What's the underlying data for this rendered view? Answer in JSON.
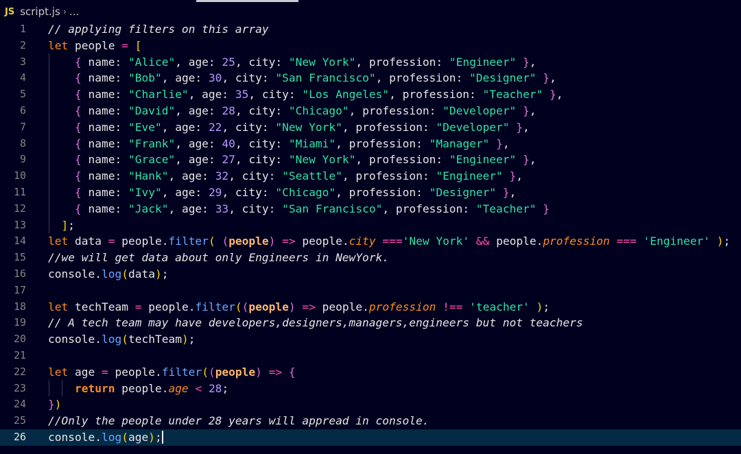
{
  "breadcrumb": {
    "lang_badge": "JS",
    "file": "script.js",
    "separator": "›",
    "more": "..."
  },
  "editor": {
    "current_line": 26,
    "lines": [
      {
        "n": "1",
        "tokens": [
          [
            "cmt",
            "// applying filters on this array"
          ]
        ]
      },
      {
        "n": "2",
        "tokens": [
          [
            "kw",
            "let"
          ],
          [
            "var",
            " people "
          ],
          [
            "op",
            "="
          ],
          [
            "var",
            " "
          ],
          [
            "b1",
            "["
          ]
        ]
      },
      {
        "n": "3",
        "indent": "    ",
        "tokens": [
          [
            "b2",
            "{"
          ],
          [
            "prop",
            " name: "
          ],
          [
            "str",
            "\"Alice\""
          ],
          [
            "punc",
            ", age: "
          ],
          [
            "num",
            "25"
          ],
          [
            "punc",
            ", city: "
          ],
          [
            "str",
            "\"New York\""
          ],
          [
            "punc",
            ", profession: "
          ],
          [
            "str",
            "\"Engineer\""
          ],
          [
            "punc",
            " "
          ],
          [
            "b2",
            "}"
          ],
          [
            "punc",
            ","
          ]
        ]
      },
      {
        "n": "4",
        "indent": "    ",
        "tokens": [
          [
            "b2",
            "{"
          ],
          [
            "prop",
            " name: "
          ],
          [
            "str",
            "\"Bob\""
          ],
          [
            "punc",
            ", age: "
          ],
          [
            "num",
            "30"
          ],
          [
            "punc",
            ", city: "
          ],
          [
            "str",
            "\"San Francisco\""
          ],
          [
            "punc",
            ", profession: "
          ],
          [
            "str",
            "\"Designer\""
          ],
          [
            "punc",
            " "
          ],
          [
            "b2",
            "}"
          ],
          [
            "punc",
            ","
          ]
        ]
      },
      {
        "n": "5",
        "indent": "    ",
        "tokens": [
          [
            "b2",
            "{"
          ],
          [
            "prop",
            " name: "
          ],
          [
            "str",
            "\"Charlie\""
          ],
          [
            "punc",
            ", age: "
          ],
          [
            "num",
            "35"
          ],
          [
            "punc",
            ", city: "
          ],
          [
            "str",
            "\"Los Angeles\""
          ],
          [
            "punc",
            ", profession: "
          ],
          [
            "str",
            "\"Teacher\""
          ],
          [
            "punc",
            " "
          ],
          [
            "b2",
            "}"
          ],
          [
            "punc",
            ","
          ]
        ]
      },
      {
        "n": "6",
        "indent": "    ",
        "tokens": [
          [
            "b2",
            "{"
          ],
          [
            "prop",
            " name: "
          ],
          [
            "str",
            "\"David\""
          ],
          [
            "punc",
            ", age: "
          ],
          [
            "num",
            "28"
          ],
          [
            "punc",
            ", city: "
          ],
          [
            "str",
            "\"Chicago\""
          ],
          [
            "punc",
            ", profession: "
          ],
          [
            "str",
            "\"Developer\""
          ],
          [
            "punc",
            " "
          ],
          [
            "b2",
            "}"
          ],
          [
            "punc",
            ","
          ]
        ]
      },
      {
        "n": "7",
        "indent": "    ",
        "tokens": [
          [
            "b2",
            "{"
          ],
          [
            "prop",
            " name: "
          ],
          [
            "str",
            "\"Eve\""
          ],
          [
            "punc",
            ", age: "
          ],
          [
            "num",
            "22"
          ],
          [
            "punc",
            ", city: "
          ],
          [
            "str",
            "\"New York\""
          ],
          [
            "punc",
            ", profession: "
          ],
          [
            "str",
            "\"Developer\""
          ],
          [
            "punc",
            " "
          ],
          [
            "b2",
            "}"
          ],
          [
            "punc",
            ","
          ]
        ]
      },
      {
        "n": "8",
        "indent": "    ",
        "tokens": [
          [
            "b2",
            "{"
          ],
          [
            "prop",
            " name: "
          ],
          [
            "str",
            "\"Frank\""
          ],
          [
            "punc",
            ", age: "
          ],
          [
            "num",
            "40"
          ],
          [
            "punc",
            ", city: "
          ],
          [
            "str",
            "\"Miami\""
          ],
          [
            "punc",
            ", profession: "
          ],
          [
            "str",
            "\"Manager\""
          ],
          [
            "punc",
            " "
          ],
          [
            "b2",
            "}"
          ],
          [
            "punc",
            ","
          ]
        ]
      },
      {
        "n": "9",
        "indent": "    ",
        "tokens": [
          [
            "b2",
            "{"
          ],
          [
            "prop",
            " name: "
          ],
          [
            "str",
            "\"Grace\""
          ],
          [
            "punc",
            ", age: "
          ],
          [
            "num",
            "27"
          ],
          [
            "punc",
            ", city: "
          ],
          [
            "str",
            "\"New York\""
          ],
          [
            "punc",
            ", profession: "
          ],
          [
            "str",
            "\"Engineer\""
          ],
          [
            "punc",
            " "
          ],
          [
            "b2",
            "}"
          ],
          [
            "punc",
            ","
          ]
        ]
      },
      {
        "n": "10",
        "indent": "    ",
        "tokens": [
          [
            "b2",
            "{"
          ],
          [
            "prop",
            " name: "
          ],
          [
            "str",
            "\"Hank\""
          ],
          [
            "punc",
            ", age: "
          ],
          [
            "num",
            "32"
          ],
          [
            "punc",
            ", city: "
          ],
          [
            "str",
            "\"Seattle\""
          ],
          [
            "punc",
            ", profession: "
          ],
          [
            "str",
            "\"Engineer\""
          ],
          [
            "punc",
            " "
          ],
          [
            "b2",
            "}"
          ],
          [
            "punc",
            ","
          ]
        ]
      },
      {
        "n": "11",
        "indent": "    ",
        "tokens": [
          [
            "b2",
            "{"
          ],
          [
            "prop",
            " name: "
          ],
          [
            "str",
            "\"Ivy\""
          ],
          [
            "punc",
            ", age: "
          ],
          [
            "num",
            "29"
          ],
          [
            "punc",
            ", city: "
          ],
          [
            "str",
            "\"Chicago\""
          ],
          [
            "punc",
            ", profession: "
          ],
          [
            "str",
            "\"Designer\""
          ],
          [
            "punc",
            " "
          ],
          [
            "b2",
            "}"
          ],
          [
            "punc",
            ","
          ]
        ]
      },
      {
        "n": "12",
        "indent": "    ",
        "tokens": [
          [
            "b2",
            "{"
          ],
          [
            "prop",
            " name: "
          ],
          [
            "str",
            "\"Jack\""
          ],
          [
            "punc",
            ", age: "
          ],
          [
            "num",
            "33"
          ],
          [
            "punc",
            ", city: "
          ],
          [
            "str",
            "\"San Francisco\""
          ],
          [
            "punc",
            ", profession: "
          ],
          [
            "str",
            "\"Teacher\""
          ],
          [
            "punc",
            " "
          ],
          [
            "b2",
            "}"
          ]
        ]
      },
      {
        "n": "13",
        "indent": "  ",
        "tokens": [
          [
            "b1",
            "]"
          ],
          [
            "punc",
            ";"
          ]
        ]
      },
      {
        "n": "14",
        "tokens": [
          [
            "kw",
            "let"
          ],
          [
            "var",
            " data "
          ],
          [
            "op",
            "="
          ],
          [
            "var",
            " people."
          ],
          [
            "fn",
            "filter"
          ],
          [
            "b1",
            "("
          ],
          [
            "var",
            " "
          ],
          [
            "b2",
            "("
          ],
          [
            "param",
            "people"
          ],
          [
            "b2",
            ")"
          ],
          [
            "var",
            " "
          ],
          [
            "op",
            "=>"
          ],
          [
            "var",
            " people."
          ],
          [
            "propi",
            "city"
          ],
          [
            "var",
            " "
          ],
          [
            "op",
            "==="
          ],
          [
            "str",
            "'New York'"
          ],
          [
            "var",
            " "
          ],
          [
            "op",
            "&&"
          ],
          [
            "var",
            " people."
          ],
          [
            "propi",
            "profession"
          ],
          [
            "var",
            " "
          ],
          [
            "op",
            "==="
          ],
          [
            "var",
            " "
          ],
          [
            "str",
            "'Engineer'"
          ],
          [
            "var",
            " "
          ],
          [
            "b1",
            ")"
          ],
          [
            "punc",
            ";"
          ]
        ]
      },
      {
        "n": "15",
        "tokens": [
          [
            "cmt",
            "//we will get data about only Engineers in NewYork."
          ]
        ]
      },
      {
        "n": "16",
        "tokens": [
          [
            "var",
            "console."
          ],
          [
            "fn",
            "log"
          ],
          [
            "b1",
            "("
          ],
          [
            "var",
            "data"
          ],
          [
            "b1",
            ")"
          ],
          [
            "punc",
            ";"
          ]
        ]
      },
      {
        "n": "17",
        "tokens": []
      },
      {
        "n": "18",
        "tokens": [
          [
            "kw",
            "let"
          ],
          [
            "var",
            " techTeam "
          ],
          [
            "op",
            "="
          ],
          [
            "var",
            " people."
          ],
          [
            "fn",
            "filter"
          ],
          [
            "b1",
            "("
          ],
          [
            "b2",
            "("
          ],
          [
            "param",
            "people"
          ],
          [
            "b2",
            ")"
          ],
          [
            "var",
            " "
          ],
          [
            "op",
            "=>"
          ],
          [
            "var",
            " people."
          ],
          [
            "propi",
            "profession"
          ],
          [
            "var",
            " "
          ],
          [
            "op",
            "!=="
          ],
          [
            "var",
            " "
          ],
          [
            "str",
            "'teacher'"
          ],
          [
            "var",
            " "
          ],
          [
            "b1",
            ")"
          ],
          [
            "punc",
            ";"
          ]
        ]
      },
      {
        "n": "19",
        "tokens": [
          [
            "cmt",
            "// A tech team may have developers,designers,managers,engineers but not teachers"
          ]
        ]
      },
      {
        "n": "20",
        "tokens": [
          [
            "var",
            "console."
          ],
          [
            "fn",
            "log"
          ],
          [
            "b1",
            "("
          ],
          [
            "var",
            "techTeam"
          ],
          [
            "b1",
            ")"
          ],
          [
            "punc",
            ";"
          ]
        ]
      },
      {
        "n": "21",
        "tokens": []
      },
      {
        "n": "22",
        "tokens": [
          [
            "kw",
            "let"
          ],
          [
            "var",
            " age "
          ],
          [
            "op",
            "="
          ],
          [
            "var",
            " people."
          ],
          [
            "fn",
            "filter"
          ],
          [
            "b1",
            "("
          ],
          [
            "b2",
            "("
          ],
          [
            "param",
            "people"
          ],
          [
            "b2",
            ")"
          ],
          [
            "var",
            " "
          ],
          [
            "op",
            "=>"
          ],
          [
            "var",
            " "
          ],
          [
            "b2",
            "{"
          ]
        ]
      },
      {
        "n": "23",
        "indent": "    ",
        "tokens": [
          [
            "kw2",
            "return"
          ],
          [
            "var",
            " people."
          ],
          [
            "propi",
            "age"
          ],
          [
            "var",
            " "
          ],
          [
            "op",
            "<"
          ],
          [
            "var",
            " "
          ],
          [
            "num",
            "28"
          ],
          [
            "punc",
            ";"
          ]
        ]
      },
      {
        "n": "24",
        "tokens": [
          [
            "b2",
            "}"
          ],
          [
            "b1",
            ")"
          ]
        ]
      },
      {
        "n": "25",
        "tokens": [
          [
            "cmt",
            "//Only the people under 28 years will appread in console."
          ]
        ]
      },
      {
        "n": "26",
        "tokens": [
          [
            "var",
            "console."
          ],
          [
            "fn",
            "log"
          ],
          [
            "b1",
            "("
          ],
          [
            "var",
            "age"
          ],
          [
            "b1",
            ")"
          ],
          [
            "punc",
            ";"
          ]
        ]
      }
    ]
  }
}
